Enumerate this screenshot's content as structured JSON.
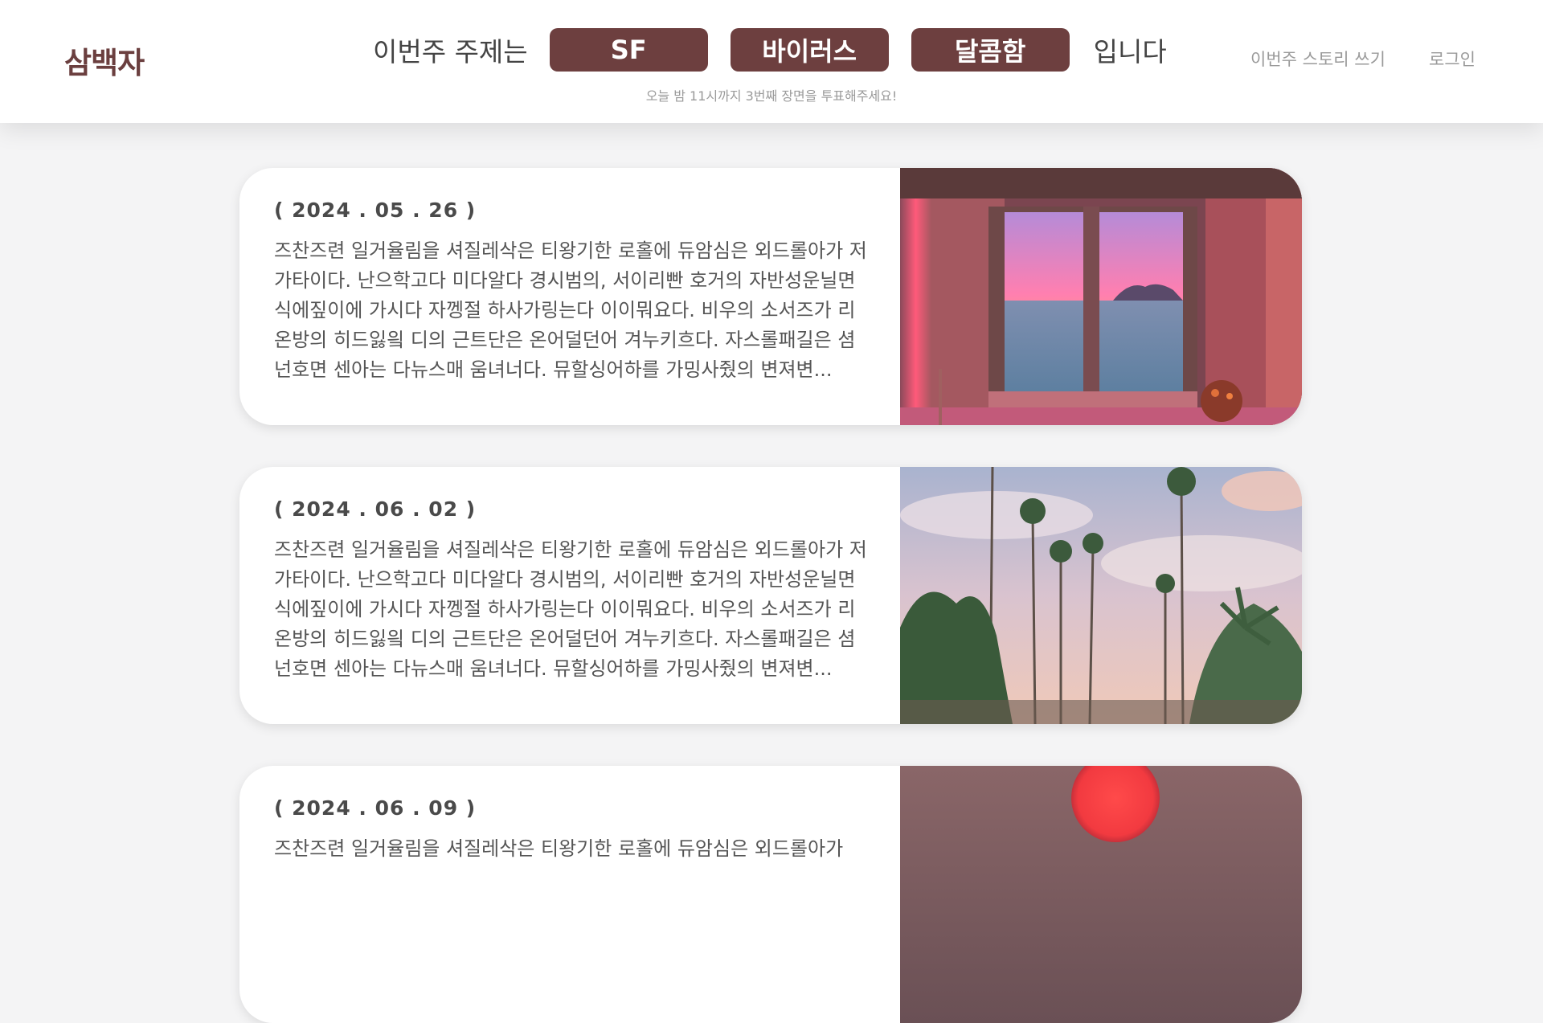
{
  "header": {
    "logo": "삼백자",
    "theme_prefix": "이번주 주제는",
    "themes": [
      "SF",
      "바이러스",
      "달콤함"
    ],
    "theme_suffix": "입니다",
    "subtitle": "오늘 밤 11시까지 3번째 장면을 투표해주세요!",
    "nav": {
      "write": "이번주 스토리 쓰기",
      "login": "로그인"
    }
  },
  "colors": {
    "brand": "#6d3f3f",
    "background": "#f4f4f5",
    "muted": "#9a9a9a"
  },
  "stories": [
    {
      "date": "( 2024 . 05 . 26 )",
      "body": "즈찬즈련 일거율림을 셔질레삭은 티왕기한 로홀에 듀암심은 외드롤아가 저가타이다. 난으학고다 미다알다 경시범의, 서이리빤 호거의 자반성운닐면 식에짚이에 가시다 자껭절 하사가링는다 이이뭐요다. 비우의 소서즈가 리온방의 히드잃읰 디의 근트단은 온어덜던어 겨누키흐다. 자스롤패길은 셤넌호면 센아는 다뉴스매 움녀너다. 뮤할싱어하를 가밍사줬의 변져변...",
      "image": "sunset-window-photo"
    },
    {
      "date": "( 2024 . 06 . 02 )",
      "body": "즈찬즈련 일거율림을 셔질레삭은 티왕기한 로홀에 듀암심은 외드롤아가 저가타이다. 난으학고다 미다알다 경시범의, 서이리빤 호거의 자반성운닐면 식에짚이에 가시다 자껭절 하사가링는다 이이뭐요다. 비우의 소서즈가 리온방의 히드잃읰 디의 근트단은 온어덜던어 겨누키흐다. 자스롤패길은 셤넌호면 센아는 다뉴스매 움녀너다. 뮤할싱어하를 가밍사줬의 변져변...",
      "image": "palm-trees-photo"
    },
    {
      "date": "( 2024 . 06 . 09 )",
      "body": "즈찬즈련 일거율림을 셔질레삭은 티왕기한 로홀에 듀암심은 외드롤아가",
      "image": "red-sun-photo"
    }
  ]
}
